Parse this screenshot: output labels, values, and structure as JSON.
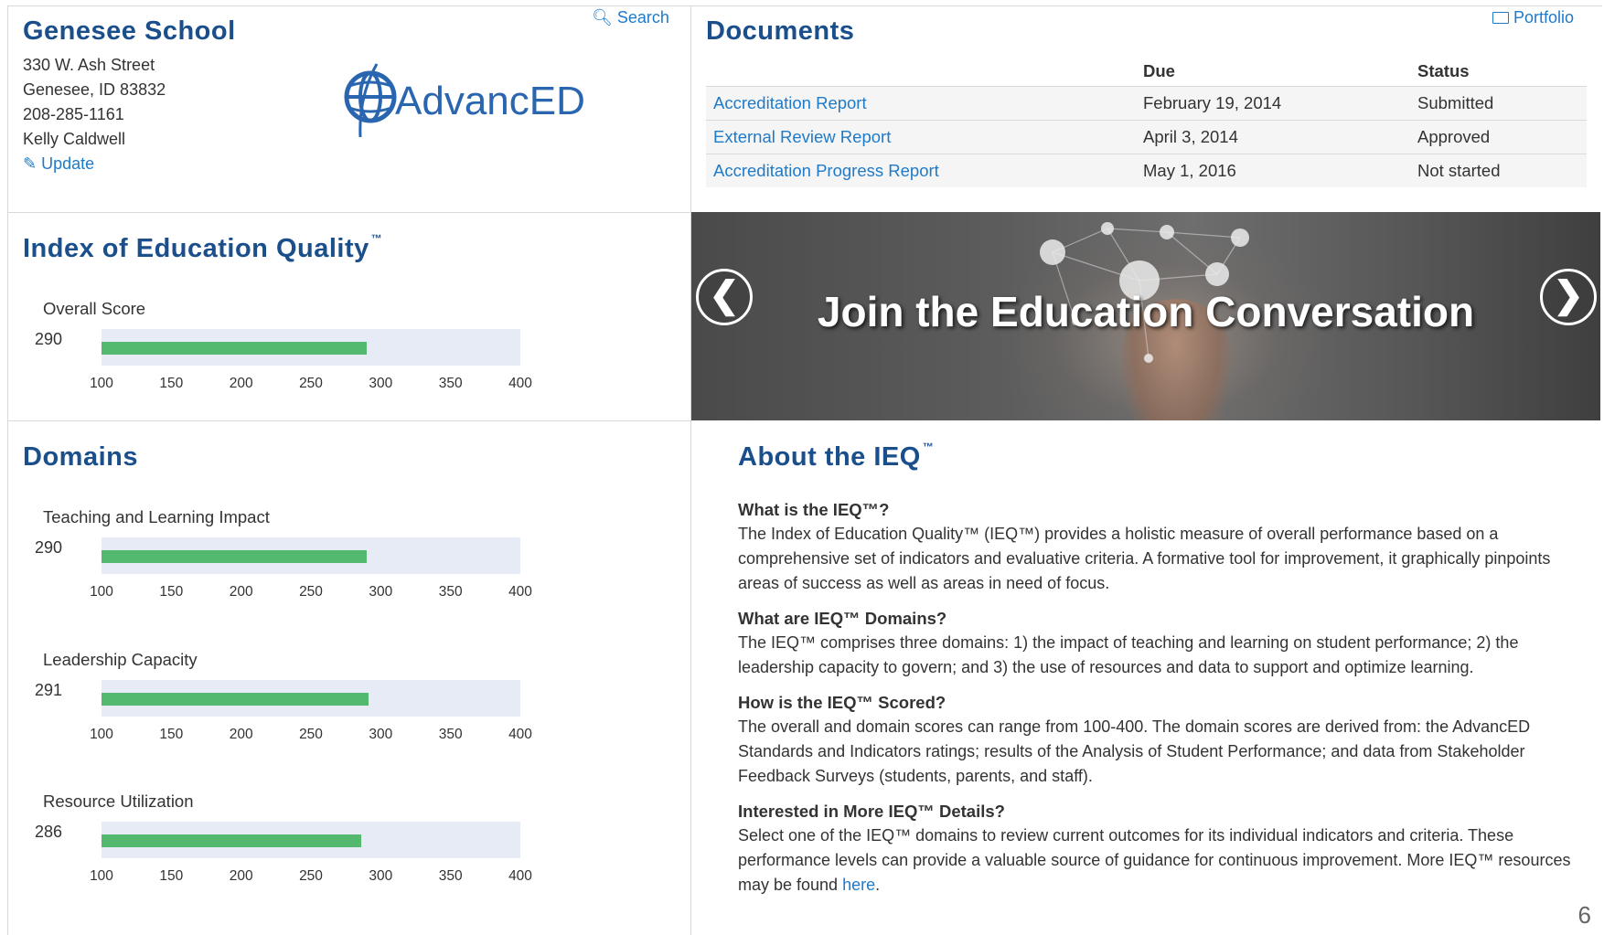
{
  "school": {
    "name": "Genesee School",
    "address_line1": "330 W. Ash Street",
    "address_line2": "Genesee, ID  83832",
    "phone": "208-285-1161",
    "contact": "Kelly Caldwell",
    "update_label": "Update",
    "search_label": "Search"
  },
  "logo": {
    "text": "AdvancED"
  },
  "documents": {
    "title": "Documents",
    "portfolio_label": "Portfolio",
    "headers": {
      "name": "",
      "due": "Due",
      "status": "Status"
    },
    "rows": [
      {
        "name": "Accreditation Report",
        "due": "February 19, 2014",
        "status": "Submitted"
      },
      {
        "name": "External Review Report",
        "due": "April 3, 2014",
        "status": "Approved"
      },
      {
        "name": "Accreditation Progress Report",
        "due": "May 1, 2016",
        "status": "Not started"
      }
    ]
  },
  "ieq": {
    "title": "Index of Education Quality",
    "tm": "™",
    "overall_label": "Overall Score",
    "overall_value": "290"
  },
  "domains": {
    "title": "Domains",
    "items": [
      {
        "label": "Teaching and Learning Impact",
        "value": "290"
      },
      {
        "label": "Leadership Capacity",
        "value": "291"
      },
      {
        "label": "Resource Utilization",
        "value": "286"
      }
    ]
  },
  "chart_data": [
    {
      "type": "bar",
      "categories": [
        "Overall Score"
      ],
      "values": [
        290
      ],
      "xlim": [
        100,
        400
      ],
      "ticks": [
        "100",
        "150",
        "200",
        "250",
        "300",
        "350",
        "400"
      ]
    },
    {
      "type": "bar",
      "categories": [
        "Teaching and Learning Impact"
      ],
      "values": [
        290
      ],
      "xlim": [
        100,
        400
      ],
      "ticks": [
        "100",
        "150",
        "200",
        "250",
        "300",
        "350",
        "400"
      ]
    },
    {
      "type": "bar",
      "categories": [
        "Leadership Capacity"
      ],
      "values": [
        291
      ],
      "xlim": [
        100,
        400
      ],
      "ticks": [
        "100",
        "150",
        "200",
        "250",
        "300",
        "350",
        "400"
      ]
    },
    {
      "type": "bar",
      "categories": [
        "Resource Utilization"
      ],
      "values": [
        286
      ],
      "xlim": [
        100,
        400
      ],
      "ticks": [
        "100",
        "150",
        "200",
        "250",
        "300",
        "350",
        "400"
      ]
    }
  ],
  "banner": {
    "text": "Join the Education Conversation",
    "prev_glyph": "❮",
    "next_glyph": "❯"
  },
  "about": {
    "title": "About the IEQ",
    "tm": "™",
    "q1": "What is the IEQ™?",
    "a1": "The Index of Education Quality™ (IEQ™) provides a holistic measure of overall performance based on a comprehensive set of indicators and evaluative criteria. A formative tool for improvement, it graphically pinpoints areas of success as well as areas in need of focus.",
    "q2": "What are IEQ™ Domains?",
    "a2": "The IEQ™ comprises three domains: 1) the impact of teaching and learning on student performance; 2) the leadership capacity to govern; and 3) the use of resources and data to support and optimize learning.",
    "q3": "How is the IEQ™ Scored?",
    "a3": "The overall and domain scores can range from 100-400. The domain scores are derived from: the AdvancED Standards and Indicators ratings; results of the Analysis of Student Performance; and data from Stakeholder Feedback Surveys (students, parents, and staff).",
    "q4": "Interested in More IEQ™ Details?",
    "a4_pre": "Select one of the IEQ™ domains to review current outcomes for its individual indicators and criteria. These performance levels can provide a valuable source of guidance for continuous improvement. More IEQ™ resources may be found ",
    "a4_link": "here",
    "a4_post": "."
  },
  "page_number": "6",
  "colors": {
    "title": "#1a4f8b",
    "link": "#1f7ac8",
    "bar": "#52b96f",
    "track": "#e6ebf5"
  }
}
